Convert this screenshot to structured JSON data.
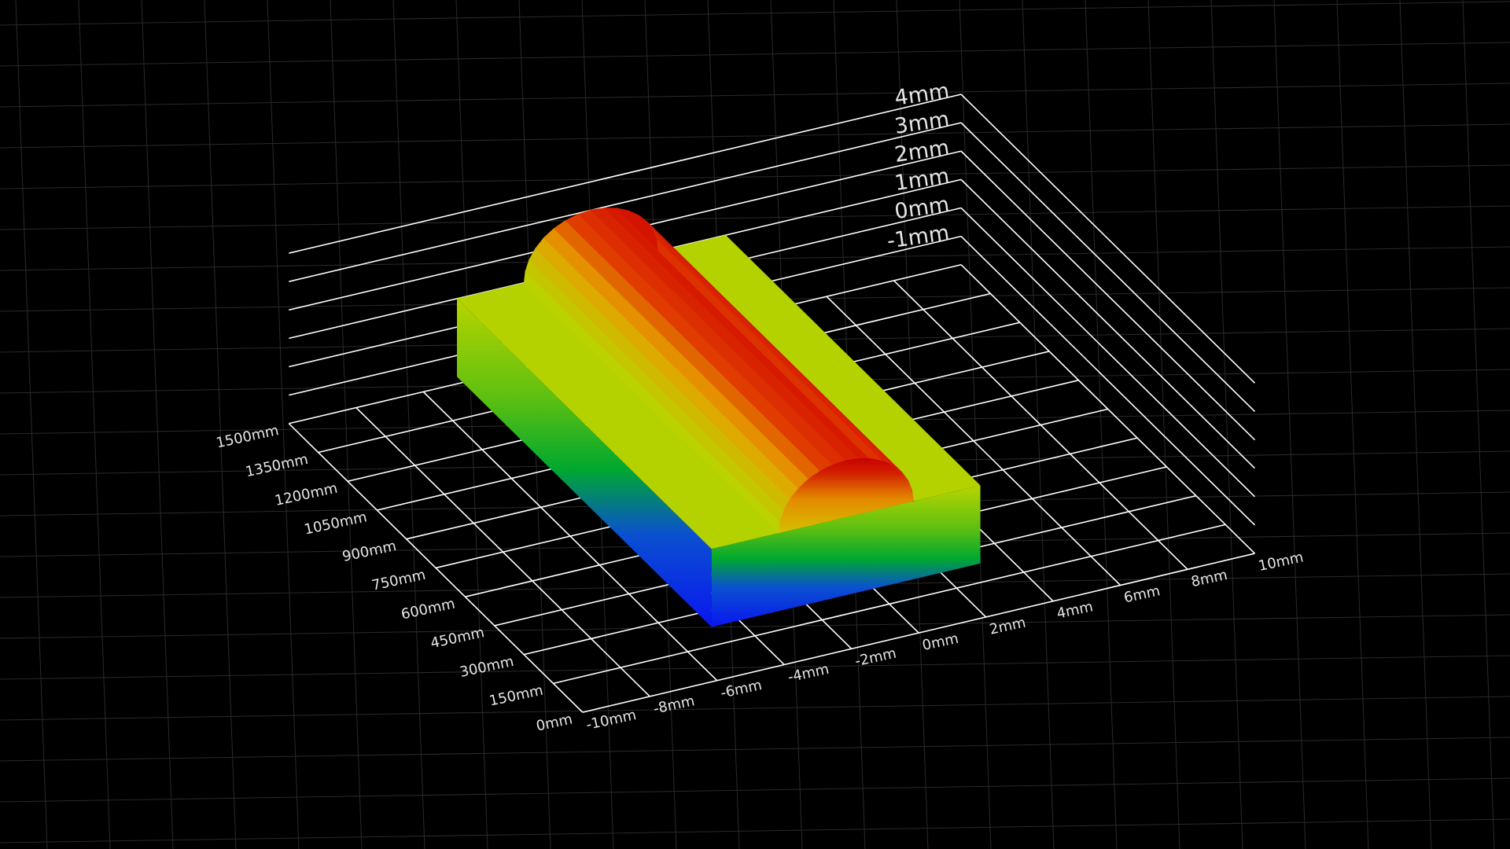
{
  "chart_data": {
    "type": "surface-3d",
    "title": "",
    "x_axis": {
      "ticks": [
        "-10mm",
        "-8mm",
        "-6mm",
        "-4mm",
        "-2mm",
        "0mm",
        "2mm",
        "4mm",
        "6mm",
        "8mm",
        "10mm"
      ],
      "range": [
        -10,
        10
      ],
      "unit": "mm"
    },
    "y_axis": {
      "ticks": [
        "0mm",
        "150mm",
        "300mm",
        "450mm",
        "600mm",
        "750mm",
        "900mm",
        "1050mm",
        "1200mm",
        "1350mm",
        "1500mm"
      ],
      "range": [
        0,
        1500
      ],
      "unit": "mm"
    },
    "z_axis": {
      "ticks": [
        "-1mm",
        "0mm",
        "1mm",
        "2mm",
        "3mm",
        "4mm"
      ],
      "range": [
        -1,
        4
      ],
      "unit": "mm"
    },
    "surface": {
      "base_top_z": 1.0,
      "ridge_top_z": 3.0,
      "base_x_extent": [
        -5,
        3
      ],
      "ridge_x_extent": [
        -3,
        1
      ],
      "y_extent": [
        200,
        1500
      ]
    },
    "colormap": [
      "#0a1aff",
      "#00b020",
      "#b7d800",
      "#e8b000",
      "#e02000",
      "#d00000"
    ],
    "grid": true
  }
}
